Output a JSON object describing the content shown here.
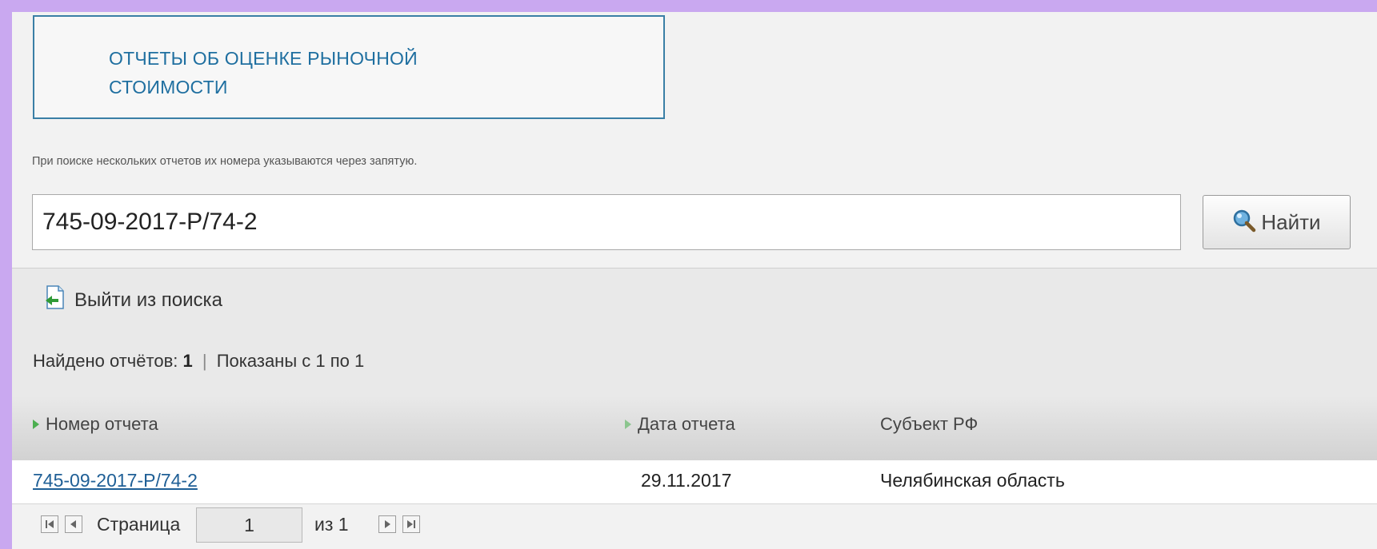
{
  "header": {
    "title_line1": "ОТЧЕТЫ ОБ ОЦЕНКЕ РЫНОЧНОЙ",
    "title_line2": "СТОИМОСТИ"
  },
  "search": {
    "hint": "При поиске нескольких отчетов их номера указываются через запятую.",
    "value": "745-09-2017-Р/74-2",
    "button_label": "Найти"
  },
  "results": {
    "exit_label": "Выйти из поиска",
    "found_label": "Найдено отчётов:",
    "found_count": "1",
    "shown_label": "Показаны с 1 по 1"
  },
  "table": {
    "columns": [
      "Номер отчета",
      "Дата отчета",
      "Субъект РФ"
    ],
    "rows": [
      {
        "number": "745-09-2017-Р/74-2",
        "date": "29.11.2017",
        "region": "Челябинская область"
      }
    ]
  },
  "pager": {
    "page_label": "Страница",
    "page_value": "1",
    "of_label": "из 1"
  },
  "colors": {
    "accent": "#1f6fa0",
    "link": "#1f5f96",
    "sort_arrow": "#4caf50",
    "frame": "#c9a8f0"
  }
}
